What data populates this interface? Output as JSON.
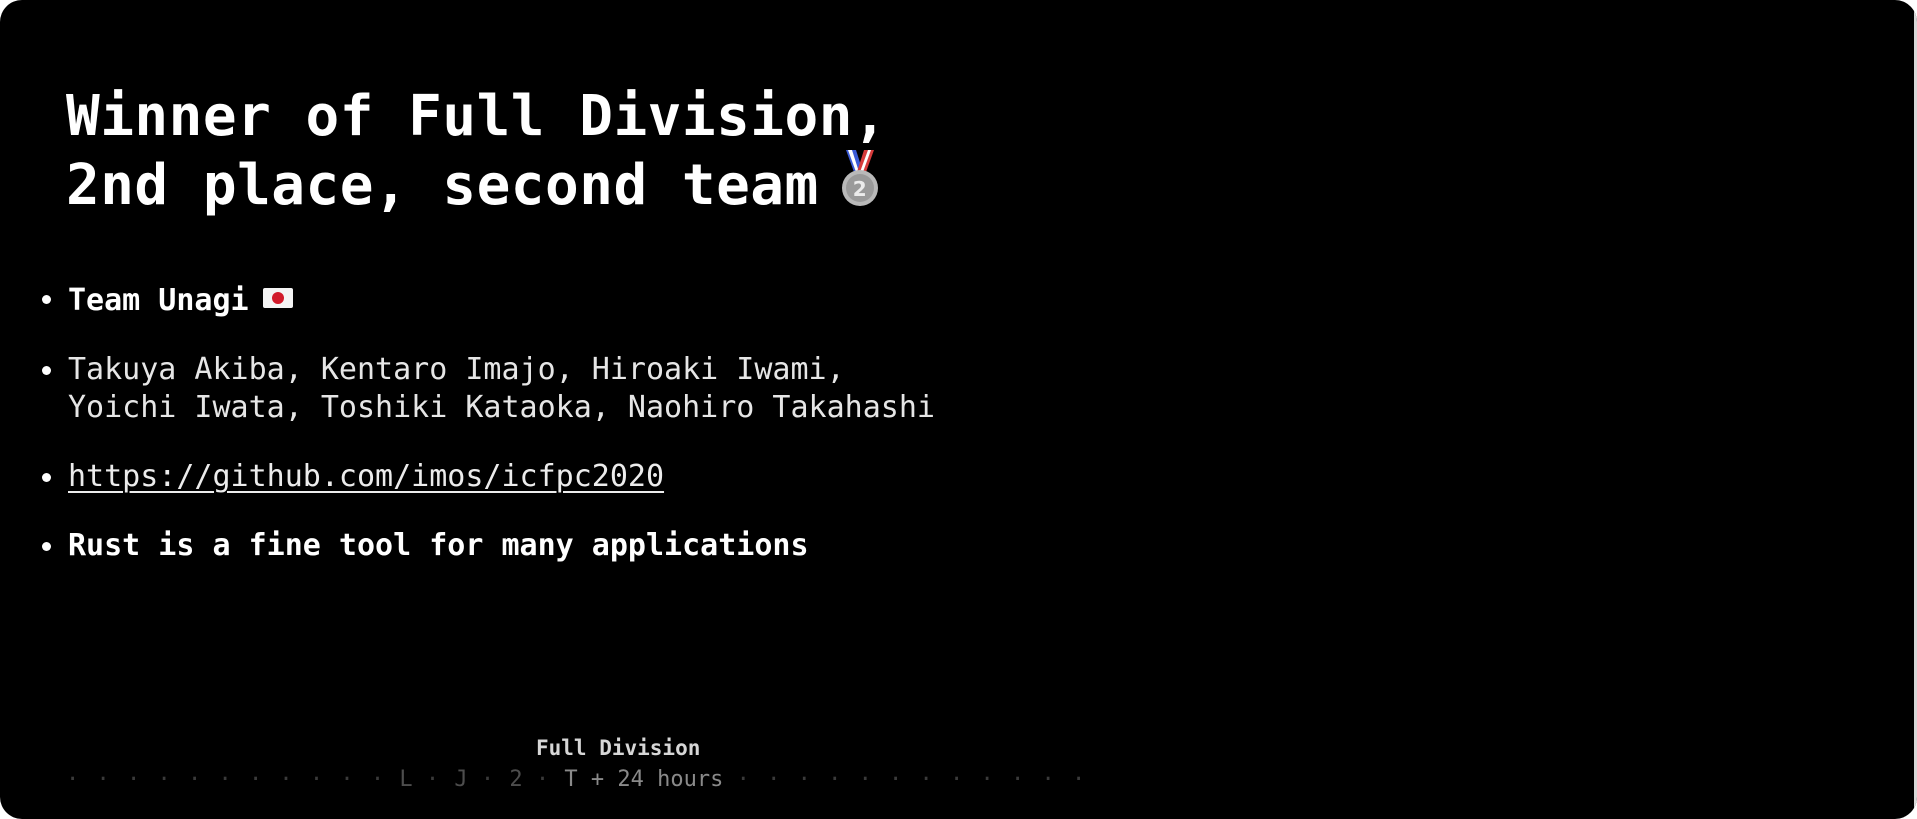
{
  "slide": {
    "title_line1": "Winner of Full Division,",
    "title_line2": "2nd place, second team",
    "medal_icon": "second-place-medal-icon",
    "bullets": [
      {
        "text": "Team Unagi",
        "icon": "japan-flag-icon"
      },
      {
        "line1": "Takuya Akiba, Kentaro Imajo, Hiroaki Iwami,",
        "line2": "Yoichi Iwata, Toshiki Kataoka, Naohiro Takahashi"
      },
      {
        "text": "https://github.com/imos/icfpc2020"
      },
      {
        "text": "Rust is a fine tool for many applications"
      }
    ]
  },
  "footer": {
    "label": "Full Division",
    "nav_left_dots": "· · · · · · · · · · ·",
    "nav_item_1": "L",
    "nav_item_2": "J",
    "nav_item_3": "2",
    "nav_current": "T + 24 hours",
    "nav_right_dots": "· · · · · · · · · · · ·"
  },
  "colors": {
    "background": "#000000",
    "text": "#ffffff",
    "footer_dim": "#4d4d4d"
  }
}
